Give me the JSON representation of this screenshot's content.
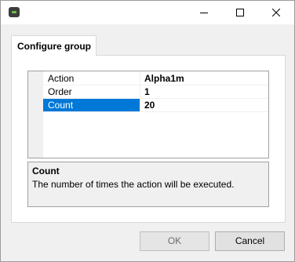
{
  "window": {
    "controls": [
      "minimize-icon",
      "maximize-icon",
      "close-icon"
    ]
  },
  "tab": {
    "label": "Configure group"
  },
  "grid": {
    "rows": [
      {
        "name": "Action",
        "value": "Alpha1m",
        "selected": false
      },
      {
        "name": "Order",
        "value": "1",
        "selected": false
      },
      {
        "name": "Count",
        "value": "20",
        "selected": true
      }
    ]
  },
  "help": {
    "title": "Count",
    "description": "The number of times the action will be executed."
  },
  "buttons": {
    "ok_label": "OK",
    "ok_enabled": false,
    "cancel_label": "Cancel"
  },
  "colors": {
    "selection": "#0078d7",
    "app_icon_accent": "#6cc04a"
  }
}
